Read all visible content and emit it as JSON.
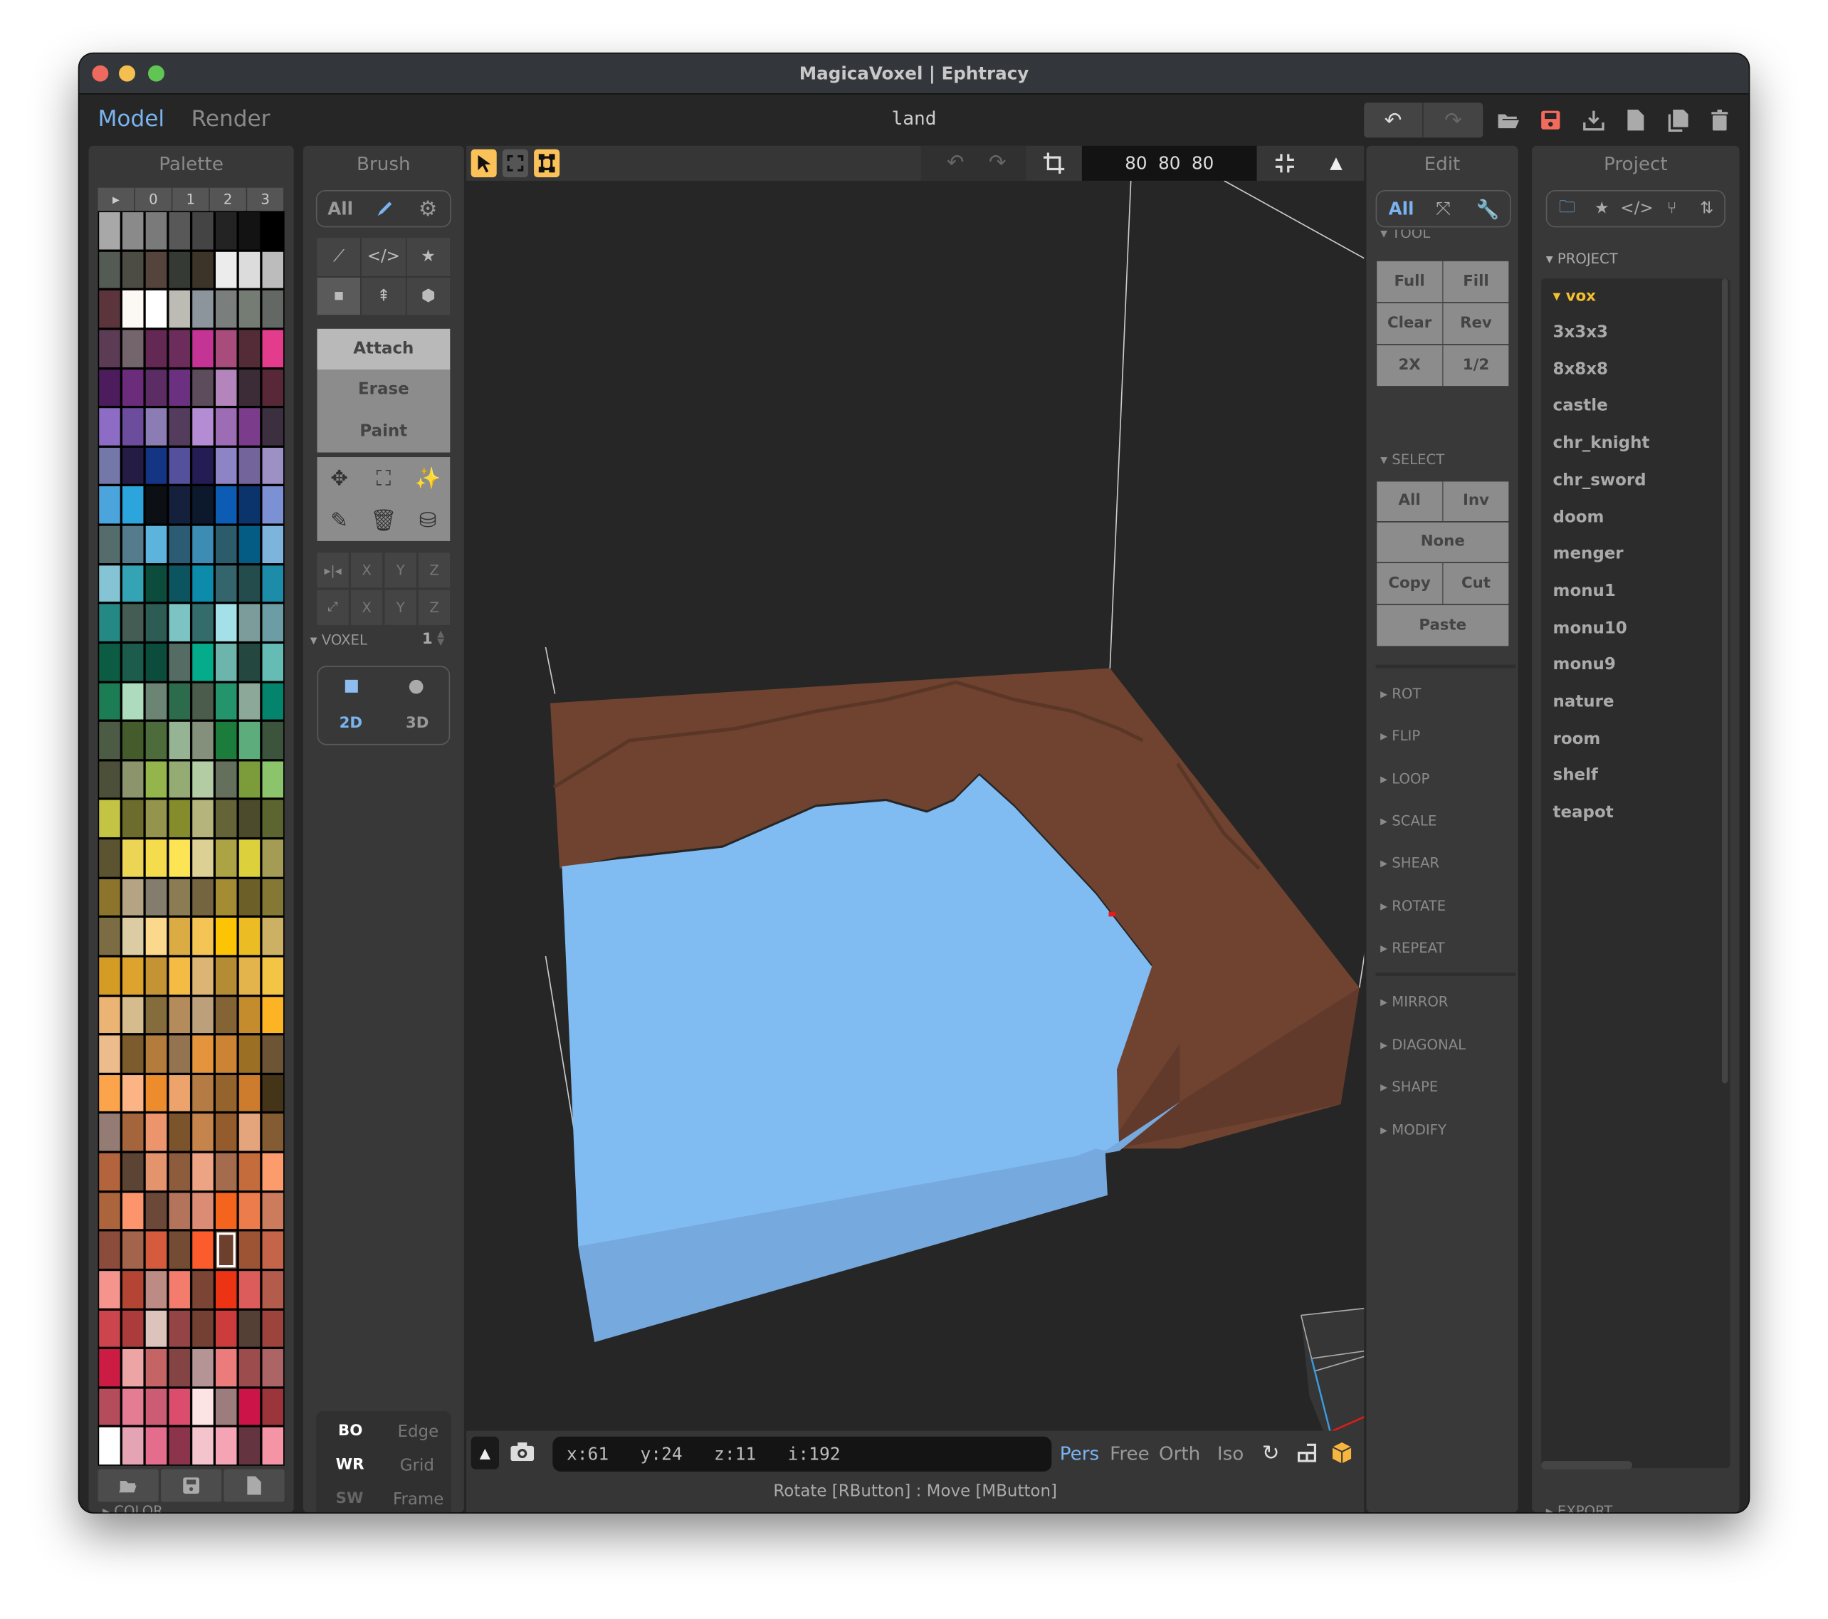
{
  "window": {
    "title": "MagicaVoxel | Ephtracy"
  },
  "header": {
    "modes": [
      {
        "label": "Model",
        "active": true
      },
      {
        "label": "Render",
        "active": false
      }
    ],
    "file_name": "land",
    "icons": [
      "undo-icon",
      "redo-icon",
      "open-folder-icon",
      "save-icon",
      "export-icon",
      "new-file-icon",
      "duplicate-icon",
      "delete-icon"
    ]
  },
  "palette": {
    "title": "Palette",
    "tabs": [
      "▸",
      "0",
      "1",
      "2",
      "3"
    ],
    "colors": [
      [
        "#a8a8a8",
        "#8a8a8a",
        "#7a7a7a",
        "#585858",
        "#444444",
        "#232323",
        "#131313",
        "#000000"
      ],
      [
        "#545a54",
        "#4c4c44",
        "#54443c",
        "#363a34",
        "#3c3428",
        "#ececec",
        "#dcdcdc",
        "#bcbcbc"
      ],
      [
        "#5c343c",
        "#fcf8f4",
        "#ffffff",
        "#bcbcb4",
        "#8c949c",
        "#7a7e7c",
        "#747c74",
        "#646864"
      ],
      [
        "#5c3c54",
        "#74646c",
        "#642854",
        "#6c2c5c",
        "#c43494",
        "#a84c7c",
        "#542c38",
        "#e43c8c"
      ],
      [
        "#4c1c5c",
        "#6c2c7c",
        "#5c2c64",
        "#6c3080",
        "#5c4c5c",
        "#b484bc",
        "#3c2c38",
        "#582838"
      ],
      [
        "#8c6cc4",
        "#6c4c9c",
        "#8c7cb4",
        "#543c5c",
        "#b48cd4",
        "#9c6cb4",
        "#7c3c8c",
        "#3c3040"
      ],
      [
        "#7478a8",
        "#241c44",
        "#143484",
        "#54509c",
        "#241c54",
        "#8c84c4",
        "#74649c",
        "#9c90c4"
      ],
      [
        "#4ca4dc",
        "#2ca4dc",
        "#0c1014",
        "#14203c",
        "#0c182c",
        "#0c5cb4",
        "#0c346c",
        "#7c90d4"
      ],
      [
        "#546c6c",
        "#547c8c",
        "#5cb4dc",
        "#2c5c74",
        "#3c8cb4",
        "#2c5c6c",
        "#045c84",
        "#7cb4dc"
      ],
      [
        "#84c4d4",
        "#34a4b4",
        "#0c4c3c",
        "#0c5460",
        "#0c8caa",
        "#34646c",
        "#244c4c",
        "#1c8ca8"
      ],
      [
        "#248884",
        "#445c54",
        "#2c5c54",
        "#7cc4c4",
        "#346c6c",
        "#a4e0e8",
        "#7c9c9c",
        "#6c9ca4"
      ],
      [
        "#0c5c44",
        "#1c5c4c",
        "#0c4c3c",
        "#546c64",
        "#04ac8c",
        "#6cb4ac",
        "#244840",
        "#64bcb4"
      ],
      [
        "#1c7c54",
        "#acdcbc",
        "#6c8474",
        "#2c6c4c",
        "#4c5c4c",
        "#24946c",
        "#8ca898",
        "#04846c"
      ],
      [
        "#4c5c44",
        "#445c2c",
        "#4c6c3c",
        "#94b494",
        "#84907c",
        "#1c7c3c",
        "#5cac7c",
        "#3c543c"
      ],
      [
        "#4c5038",
        "#8c946c",
        "#94b44c",
        "#94ac74",
        "#b4cca4",
        "#64705c",
        "#7c9c3c",
        "#8cc46c"
      ],
      [
        "#c4c444",
        "#6c6c2c",
        "#94944c",
        "#848c2c",
        "#b4b47c",
        "#646438",
        "#4c4c2c",
        "#5c6430"
      ],
      [
        "#5c5430",
        "#ecd454",
        "#f4dc4c",
        "#fce454",
        "#dcd094",
        "#aca444",
        "#dcd03c",
        "#a49c54"
      ],
      [
        "#8c742c",
        "#b4a484",
        "#847c6c",
        "#8c7c54",
        "#746440",
        "#a48c34",
        "#6c6028",
        "#847834"
      ],
      [
        "#7c6c44",
        "#dccca4",
        "#fcd88c",
        "#dcac44",
        "#f4c454",
        "#fcc404",
        "#ecbc24",
        "#ccb064"
      ],
      [
        "#d49c24",
        "#dca42c",
        "#c49434",
        "#f4bc44",
        "#dcb474",
        "#b48c34",
        "#e4b44c",
        "#f4c444"
      ],
      [
        "#ecb474",
        "#d4bc8c",
        "#846c3c",
        "#b48c5c",
        "#bca07c",
        "#846434",
        "#c48c2c",
        "#fcb424"
      ],
      [
        "#ecbc8c",
        "#7c5c2c",
        "#b47c3c",
        "#947450",
        "#e4943c",
        "#cc8434",
        "#9c7024",
        "#6c5434"
      ],
      [
        "#fca44c",
        "#fcb484",
        "#ec8c2c",
        "#eca46c",
        "#b47c44",
        "#94642c",
        "#cc7c2c",
        "#443418"
      ],
      [
        "#947c74",
        "#a4643c",
        "#ec946c",
        "#7c542c",
        "#c4844c",
        "#945c2c",
        "#e4a47c",
        "#845c34"
      ],
      [
        "#b4643c",
        "#5c4434",
        "#e4946c",
        "#8c5c3c",
        "#eca484",
        "#a46c4c",
        "#c46c3c",
        "#fc9c6c"
      ],
      [
        "#ac643c",
        "#fc946c",
        "#6c4838",
        "#b4745c",
        "#dc8c74",
        "#f4641c",
        "#ec7c4c",
        "#cc7c5c"
      ],
      [
        "#8c4c3c",
        "#a4644c",
        "#d45c3c",
        "#744c34",
        "#fc5c2c",
        "#6c402c",
        "#9c5434",
        "#c46448"
      ],
      [
        "#f4948c",
        "#b44434",
        "#bc8c84",
        "#f47c6c",
        "#7c4434",
        "#ec3414",
        "#dc5c5c",
        "#b45c4c"
      ],
      [
        "#cc444c",
        "#ac3c3c",
        "#dcc4bc",
        "#944444",
        "#744034",
        "#cc3c3c",
        "#544034",
        "#9c443c"
      ],
      [
        "#cc1c44",
        "#eca4a4",
        "#c46464",
        "#844444",
        "#b49494",
        "#ec7c7c",
        "#9c4c4c",
        "#ac6464"
      ],
      [
        "#b44c5c",
        "#e47c94",
        "#cc5c74",
        "#dc4c6c",
        "#fce4e4",
        "#9c7c7c",
        "#cc1448",
        "#9c343c"
      ],
      [
        "#ffffff",
        "#e4a4b4",
        "#e46c8c",
        "#8c344c",
        "#f4c4cc",
        "#f4a4b4",
        "#643440",
        "#f494a4"
      ]
    ],
    "selected": {
      "row": 26,
      "col": 5
    },
    "footer_icons": [
      "open-folder-icon",
      "save-icon",
      "new-file-icon"
    ],
    "color_section": "COLOR"
  },
  "brush": {
    "title": "Brush",
    "filter_tabs": [
      {
        "label": "All"
      },
      {
        "icon": "brush-icon"
      },
      {
        "icon": "gear-icon"
      }
    ],
    "shape_tools": [
      "line-icon",
      "code-icon",
      "star-icon",
      "square-icon",
      "extrude-icon",
      "cube-icon"
    ],
    "modes": [
      "Attach",
      "Erase",
      "Paint"
    ],
    "active_mode": "Attach",
    "action_tools": [
      "move-icon",
      "select-box-icon",
      "magic-wand-icon",
      "eyedropper-icon",
      "trash-icon",
      "fill-bucket-icon"
    ],
    "mirror_row": {
      "icon": "mirror-icon",
      "axes": [
        "X",
        "Y",
        "Z"
      ]
    },
    "axis_row": {
      "icon": "resize-icon",
      "axes": [
        "X",
        "Y",
        "Z"
      ]
    },
    "voxel": {
      "label": "VOXEL",
      "value": "1",
      "shapes": [
        "2D",
        "3D"
      ],
      "active": "2D"
    },
    "display": [
      [
        "BO",
        "Edge"
      ],
      [
        "WR",
        "Grid"
      ],
      [
        "SW",
        "Frame"
      ]
    ]
  },
  "viewport": {
    "toolbar_dims": "80  80  80",
    "coords": "x:61   y:24   z:11   i:192",
    "views": [
      {
        "label": "Pers",
        "active": true
      },
      {
        "label": "Free"
      },
      {
        "label": "Orth"
      },
      {
        "label": "Iso"
      }
    ],
    "status": "Rotate [RButton] : Move [MButton]",
    "colors": {
      "water_top": "#80bcf2",
      "water_side": "#76a9de",
      "land_top": "#6f4330",
      "land_side": "#623a2c",
      "bg": "#262626"
    }
  },
  "edit": {
    "title": "Edit",
    "filter_tabs": [
      "All",
      "fit-icon",
      "wrench-icon"
    ],
    "tool_label": "TOOL",
    "tool_buttons": [
      [
        "Full",
        "Fill"
      ],
      [
        "Clear",
        "Rev"
      ],
      [
        "2X",
        "1/2"
      ]
    ],
    "select_label": "SELECT",
    "select_buttons": {
      "row1": [
        "All",
        "Inv"
      ],
      "none": "None",
      "row3": [
        "Copy",
        "Cut"
      ],
      "paste": "Paste"
    },
    "sections1": [
      "ROT",
      "FLIP",
      "LOOP",
      "SCALE",
      "SHEAR",
      "ROTATE",
      "REPEAT"
    ],
    "sections2": [
      "MIRROR",
      "DIAGONAL",
      "SHAPE",
      "MODIFY"
    ]
  },
  "project": {
    "title": "Project",
    "tab_icons": [
      "folder-icon",
      "star-icon",
      "code-icon",
      "branch-icon",
      "sort-icon"
    ],
    "section": "PROJECT",
    "folder": "vox",
    "items": [
      "3x3x3",
      "8x8x8",
      "castle",
      "chr_knight",
      "chr_sword",
      "doom",
      "menger",
      "monu1",
      "monu10",
      "monu9",
      "nature",
      "room",
      "shelf",
      "teapot"
    ],
    "export_label": "EXPORT"
  }
}
